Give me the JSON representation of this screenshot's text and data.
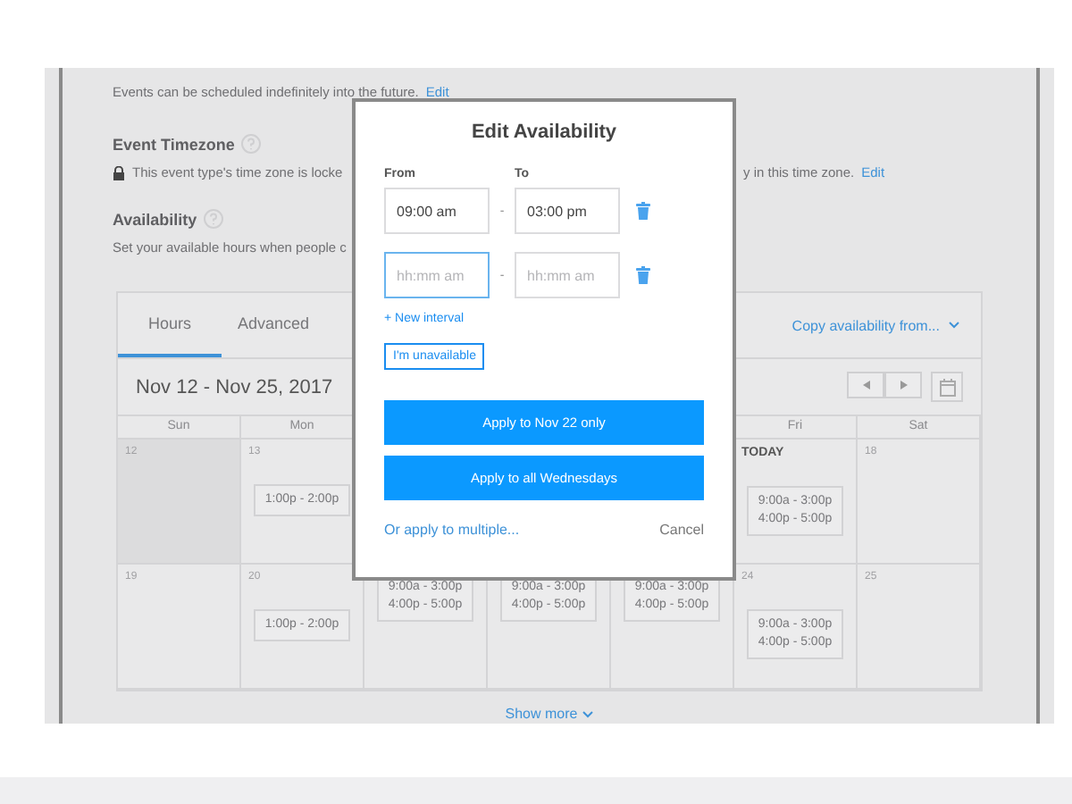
{
  "scheduling": {
    "text": "Events can be scheduled indefinitely into the future.",
    "link": "Edit"
  },
  "timezone": {
    "title": "Event Timezone",
    "text": "This event type's time zone is locke",
    "text_after": "y in this time zone.",
    "link": "Edit"
  },
  "availability": {
    "title": "Availability",
    "text": "Set your available hours when people c"
  },
  "calendar": {
    "tabs": [
      {
        "label": "Hours",
        "selected": true
      },
      {
        "label": "Advanced",
        "selected": false
      }
    ],
    "copy_link": "Copy availability from...",
    "range": "Nov 12 - Nov 25, 2017",
    "days_left": [
      "Sun",
      "Mon"
    ],
    "days_right": [
      "Fri",
      "Sat"
    ],
    "weeks": [
      {
        "left": [
          {
            "label": "12",
            "past": true
          },
          {
            "label": "13",
            "slots": [
              "1:00p - 2:00p"
            ]
          }
        ],
        "right": [
          {
            "label": "TODAY",
            "today": true,
            "slots": [
              "9:00a - 3:00p",
              "4:00p - 5:00p"
            ]
          },
          {
            "label": "18"
          }
        ]
      },
      {
        "left": [
          {
            "label": "19"
          },
          {
            "label": "20",
            "slots": [
              "1:00p - 2:00p"
            ]
          }
        ],
        "middle": [
          {
            "slots": [
              "9:00a - 3:00p",
              "4:00p - 5:00p"
            ]
          },
          {
            "slots": [
              "9:00a - 3:00p",
              "4:00p - 5:00p"
            ]
          },
          {
            "slots": [
              "9:00a - 3:00p",
              "4:00p - 5:00p"
            ]
          }
        ],
        "right": [
          {
            "label": "24",
            "slots": [
              "9:00a - 3:00p",
              "4:00p - 5:00p"
            ]
          },
          {
            "label": "25"
          }
        ]
      }
    ],
    "show_more": "Show more"
  },
  "modal": {
    "title": "Edit Availability",
    "from_label": "From",
    "to_label": "To",
    "separator": "-",
    "intervals": [
      {
        "from": {
          "value": "09:00 am",
          "focused": false
        },
        "to": {
          "value": "03:00 pm",
          "focused": false
        }
      },
      {
        "from": {
          "placeholder": "hh:mm am",
          "focused": true
        },
        "to": {
          "placeholder": "hh:mm am",
          "focused": false
        }
      }
    ],
    "new_interval": "+ New interval",
    "unavailable": "I'm unavailable",
    "apply": [
      "Apply to Nov 22 only",
      "Apply to all Wednesdays"
    ],
    "multiple_link": "Or apply to multiple...",
    "cancel": "Cancel"
  }
}
